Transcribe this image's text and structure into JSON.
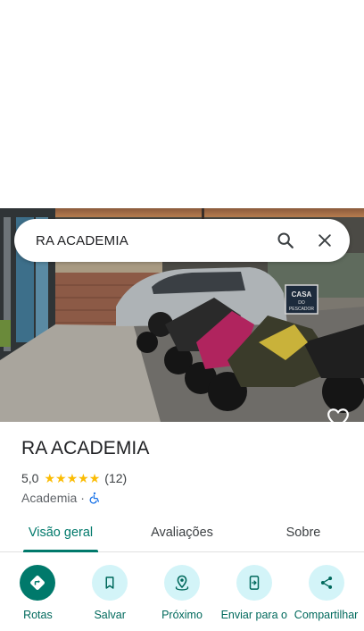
{
  "search": {
    "query": "RA ACADEMIA"
  },
  "place": {
    "name": "RA ACADEMIA",
    "rating": "5,0",
    "stars": [
      "★",
      "★",
      "★",
      "★",
      "★"
    ],
    "review_count": "(12)",
    "category": "Academia",
    "separator": "·"
  },
  "photo": {
    "sign_line1": "CASA",
    "sign_line2": "DO",
    "sign_line3": "PESCADOR"
  },
  "tabs": [
    {
      "label": "Visão geral",
      "active": true
    },
    {
      "label": "Avaliações",
      "active": false
    },
    {
      "label": "Sobre",
      "active": false
    }
  ],
  "actions": [
    {
      "label": "Rotas",
      "icon": "directions-icon"
    },
    {
      "label": "Salvar",
      "icon": "bookmark-icon"
    },
    {
      "label": "Próximo",
      "icon": "nearby-icon"
    },
    {
      "label": "Enviar para o",
      "icon": "send-to-phone-icon"
    },
    {
      "label": "Compartilhar",
      "icon": "share-icon"
    }
  ],
  "colors": {
    "accent": "#00796b",
    "star": "#fbbc04",
    "action_bg": "#d3f4f8",
    "accessibility": "#1a73e8"
  }
}
